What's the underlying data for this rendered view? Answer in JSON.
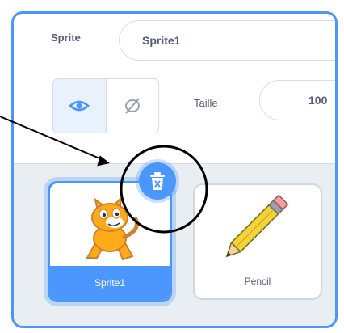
{
  "sprite_info": {
    "sprite_label": "Sprite",
    "sprite_name_value": "Sprite1",
    "show_label": "Taille",
    "size_value": "100"
  },
  "sprites": [
    {
      "name": "Sprite1",
      "selected": true,
      "icon": "cat-costume"
    },
    {
      "name": "Pencil",
      "selected": false,
      "icon": "pencil-costume"
    }
  ],
  "icons": {
    "show": "eye-icon",
    "hide": "eye-slash-icon",
    "delete": "trash-icon"
  },
  "colors": {
    "accent": "#4c97ff",
    "panel_bg": "#e9eef2",
    "text": "#575e75"
  }
}
